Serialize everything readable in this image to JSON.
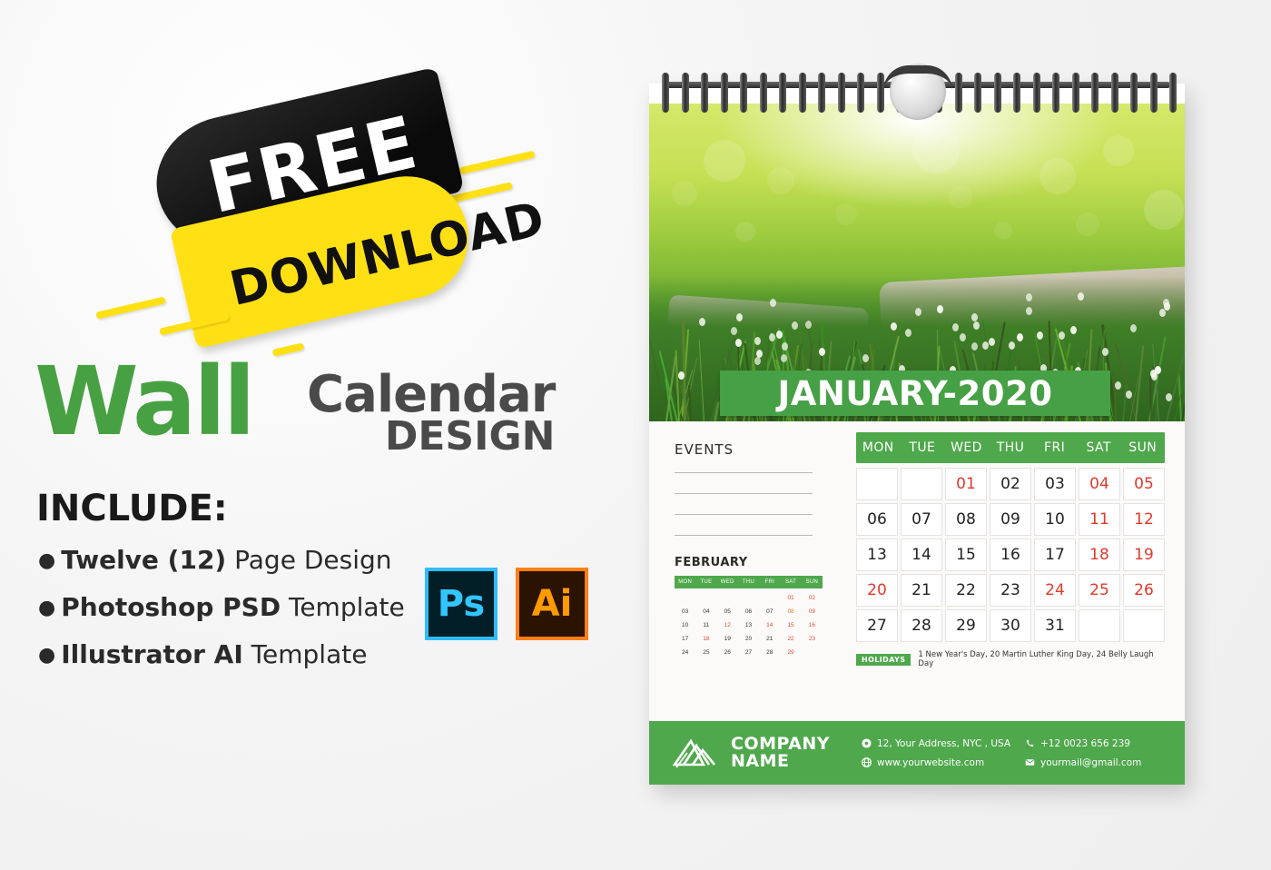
{
  "promo": {
    "badge": {
      "line1": "FREE",
      "line2": "DOWNLOAD"
    },
    "headline": {
      "wall": "Wall",
      "calendar": "Calendar",
      "design": "DESIGN"
    },
    "include_title": "INCLUDE:",
    "include_items": [
      {
        "bold": "Twelve (12)",
        "rest": " Page Design"
      },
      {
        "bold": "Photoshop PSD",
        "rest": " Template"
      },
      {
        "bold": "Illustrator AI",
        "rest": " Template"
      }
    ],
    "software_icons": [
      {
        "label": "Ps",
        "name": "photoshop-icon"
      },
      {
        "label": "Ai",
        "name": "illustrator-icon"
      }
    ]
  },
  "calendar": {
    "month_banner": "JANUARY-2020",
    "events_title": "EVENTS",
    "event_lines": [
      "",
      "",
      "",
      ""
    ],
    "mini": {
      "title": "FEBRUARY",
      "weekdays": [
        "MON",
        "TUE",
        "WED",
        "THU",
        "FRI",
        "SAT",
        "SUN"
      ],
      "weeks": [
        [
          "",
          "",
          "",
          "",
          "",
          "01",
          "02"
        ],
        [
          "03",
          "04",
          "05",
          "06",
          "07",
          "08",
          "09"
        ],
        [
          "10",
          "11",
          "12",
          "13",
          "14",
          "15",
          "16"
        ],
        [
          "17",
          "18",
          "19",
          "20",
          "21",
          "22",
          "23"
        ],
        [
          "24",
          "25",
          "26",
          "27",
          "28",
          "29",
          ""
        ]
      ]
    },
    "weekdays": [
      "MON",
      "TUE",
      "WED",
      "THU",
      "FRI",
      "SAT",
      "SUN"
    ],
    "weeks": [
      [
        "",
        "",
        "01",
        "02",
        "03",
        "04",
        "05"
      ],
      [
        "06",
        "07",
        "08",
        "09",
        "10",
        "11",
        "12"
      ],
      [
        "13",
        "14",
        "15",
        "16",
        "17",
        "18",
        "19"
      ],
      [
        "20",
        "21",
        "22",
        "23",
        "24",
        "25",
        "26"
      ],
      [
        "27",
        "28",
        "29",
        "30",
        "31",
        "",
        ""
      ]
    ],
    "holidays_label": "HOLIDAYS",
    "holidays_text": "1 New Year's Day, 20 Martin Luther King Day, 24 Belly Laugh Day",
    "footer": {
      "company_line1": "COMPANY",
      "company_line2": "NAME",
      "address": "12, Your Address, NYC , USA",
      "phone": "+12 0023 656 239",
      "website": "www.yourwebsite.com",
      "email": "yourmail@gmail.com"
    }
  },
  "colors": {
    "green": "#4fa84c",
    "banner_green": "#46a045",
    "headline_green": "#47a142",
    "yellow": "#ffe014",
    "black": "#111111",
    "weekend_red": "#e0392b",
    "dark_text": "#4a4a4a"
  }
}
